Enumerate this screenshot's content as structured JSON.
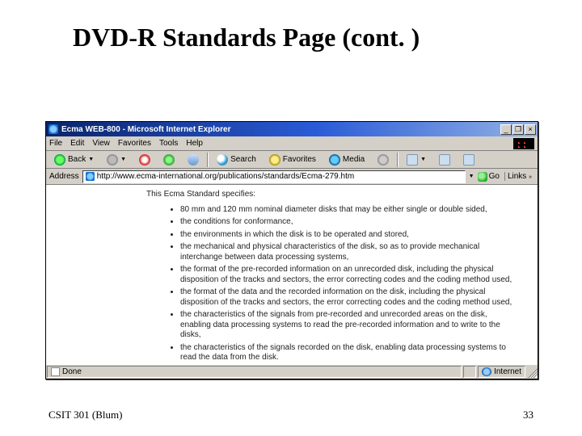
{
  "slide": {
    "title": "DVD-R Standards Page (cont. )",
    "footer_left": "CSIT 301 (Blum)",
    "footer_right": "33"
  },
  "window": {
    "title": "Ecma WEB-800 - Microsoft Internet Explorer",
    "minimize": "_",
    "maximize": "❐",
    "close": "×"
  },
  "menu": {
    "file": "File",
    "edit": "Edit",
    "view": "View",
    "favorites": "Favorites",
    "tools": "Tools",
    "help": "Help"
  },
  "toolbar": {
    "back": "Back",
    "search": "Search",
    "favorites": "Favorites",
    "media": "Media"
  },
  "address": {
    "label": "Address",
    "url": "http://www.ecma-international.org/publications/standards/Ecma-279.htm",
    "go": "Go",
    "links": "Links",
    "dropdown": "»"
  },
  "page": {
    "intro": "This Ecma Standard specifies:",
    "bullets": [
      "80 mm and 120 mm nominal diameter disks that may be either single or double sided,",
      "the conditions for conformance,",
      "the environments in which the disk is to be operated and stored,",
      "the mechanical and physical characteristics of the disk, so as to provide mechanical interchange between data processing systems,",
      "the format of the pre-recorded information on an unrecorded disk, including the physical disposition of the tracks and sectors, the error correcting codes and the coding method used,",
      "the format of the data and the recorded information on the disk, including the physical disposition of the tracks and sectors, the error correcting codes and the coding method used,",
      "the characteristics of the signals from pre-recorded and unrecorded areas on the disk, enabling data processing systems to read the pre-recorded information and to write to the disks,",
      "the characteristics of the signals recorded on the disk, enabling data processing systems to read the data from the disk."
    ]
  },
  "status": {
    "done": "Done",
    "zone": "Internet"
  }
}
